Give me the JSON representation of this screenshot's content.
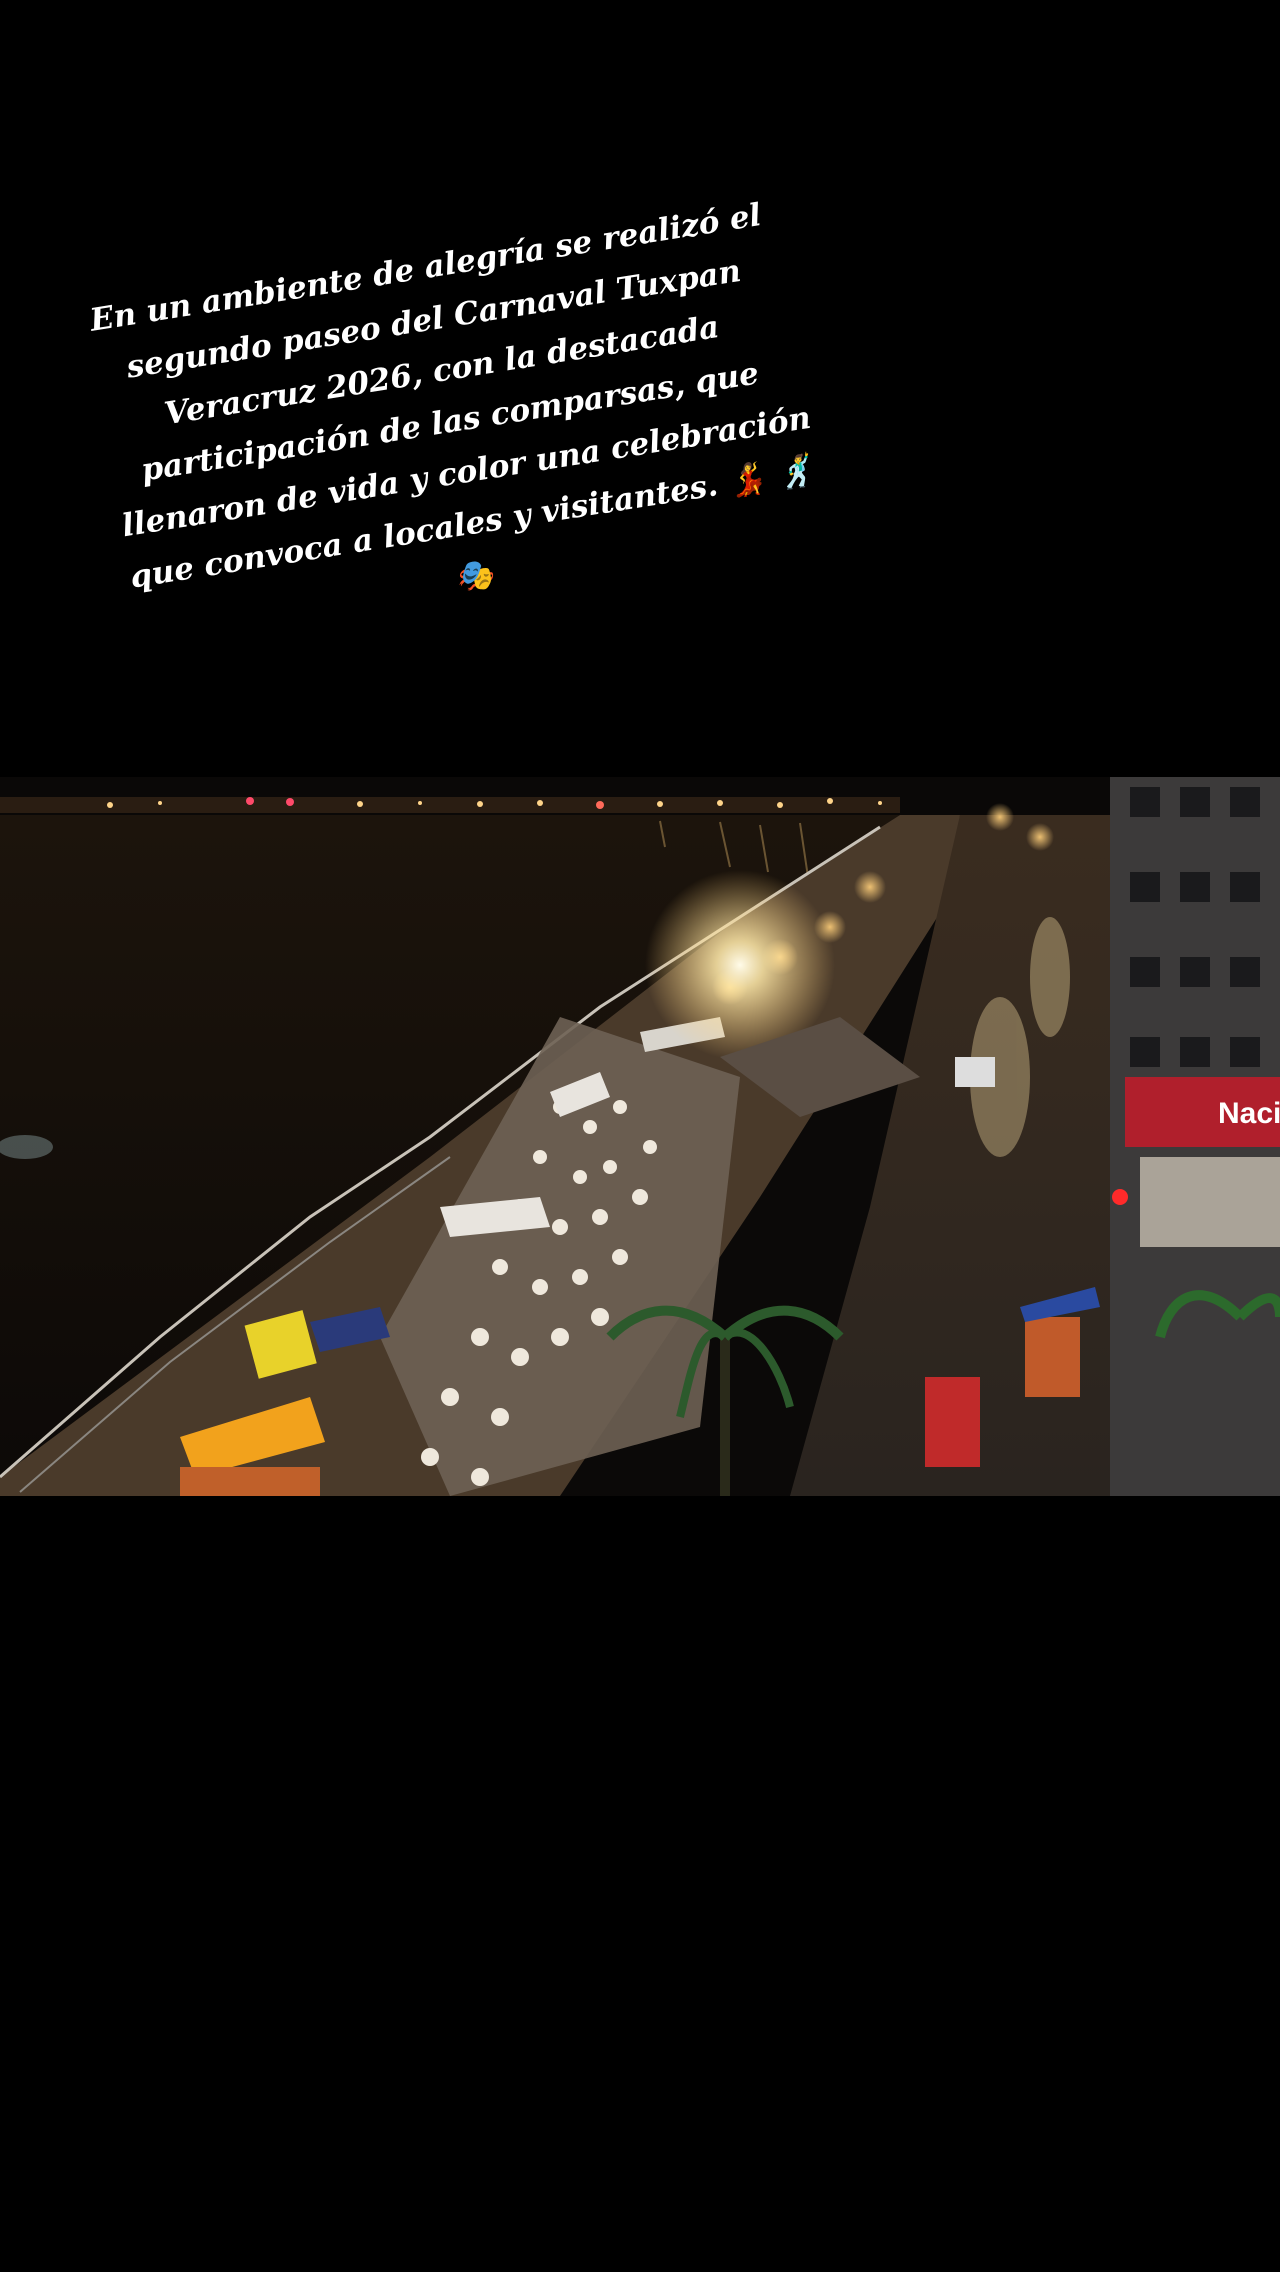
{
  "caption": {
    "lines": [
      "En un ambiente de alegría se realizó el",
      "segundo paseo del Carnaval Tuxpan",
      "Veracruz 2026, con la destacada",
      "participación de las comparsas, que",
      "llenaron de vida y color una celebración",
      "que convoca a locales y visitantes. 💃 🕺",
      "🎭"
    ]
  },
  "photo": {
    "store_sign": "Naci"
  },
  "colors": {
    "background": "#000000",
    "caption_text": "#ffffff",
    "spotlight": "#fff6d8",
    "water": "#140f0a",
    "street_lights": "#ffcf7a"
  }
}
